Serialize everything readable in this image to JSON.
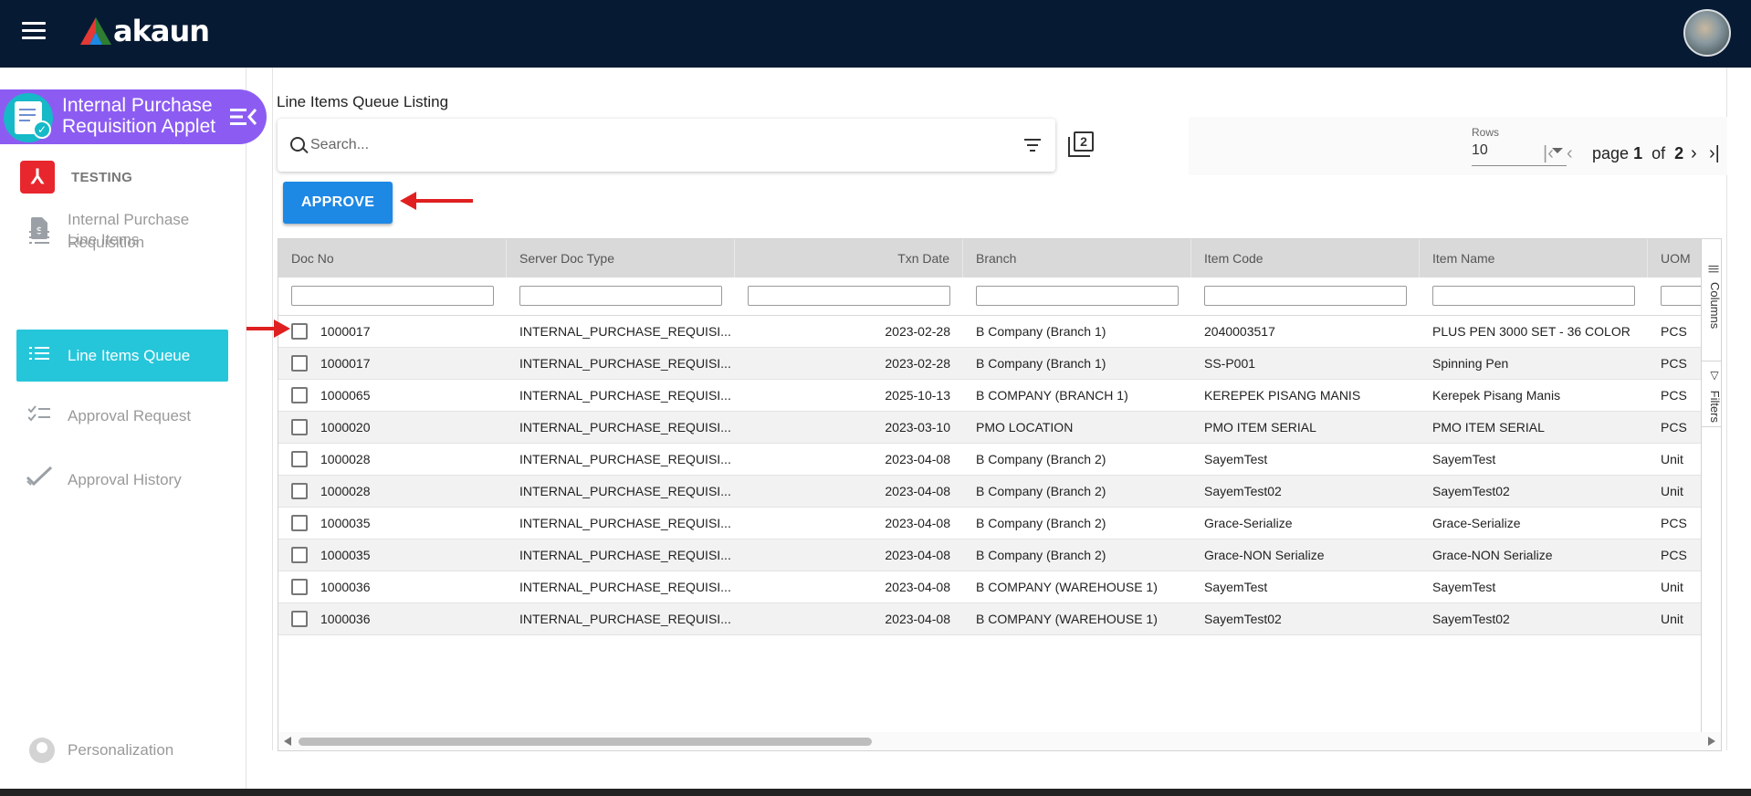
{
  "app": {
    "logo_text": "akaun"
  },
  "sidebar": {
    "applet_title_line1": "Internal Purchase",
    "applet_title_line2": "Requisition Applet",
    "company_name": "TESTING",
    "items": [
      {
        "label_line1": "Internal Purchase",
        "label_line2": "Requisition",
        "icon": "document-dollar-icon"
      },
      {
        "label": "Line Items",
        "icon": "list-icon"
      },
      {
        "label": "Line Items Queue",
        "icon": "list-icon",
        "active": true
      },
      {
        "label": "Approval Request",
        "icon": "checklist-icon"
      },
      {
        "label": "Approval History",
        "icon": "double-check-icon"
      }
    ],
    "personalization": "Personalization"
  },
  "main": {
    "page_title": "Line Items Queue Listing",
    "search_placeholder": "Search...",
    "copy_badge": "2",
    "approve_label": "APPROVE",
    "pager": {
      "rows_label": "Rows",
      "rows_value": "10",
      "page_word": "page",
      "current_page": "1",
      "of_word": "of",
      "total_pages": "2"
    }
  },
  "grid": {
    "columns": [
      "Doc No",
      "Server Doc Type",
      "Txn Date",
      "Branch",
      "Item Code",
      "Item Name",
      "UOM"
    ],
    "side_tabs": {
      "columns": "Columns",
      "filters": "Filters"
    },
    "rows": [
      [
        "1000017",
        "INTERNAL_PURCHASE_REQUISI...",
        "2023-02-28",
        "B Company (Branch 1)",
        "2040003517",
        "PLUS PEN 3000 SET - 36 COLOR",
        "PCS"
      ],
      [
        "1000017",
        "INTERNAL_PURCHASE_REQUISI...",
        "2023-02-28",
        "B Company (Branch 1)",
        "SS-P001",
        "Spinning Pen",
        "PCS"
      ],
      [
        "1000065",
        "INTERNAL_PURCHASE_REQUISI...",
        "2025-10-13",
        "B COMPANY (BRANCH 1)",
        "KEREPEK PISANG MANIS",
        "Kerepek Pisang Manis",
        "PCS"
      ],
      [
        "1000020",
        "INTERNAL_PURCHASE_REQUISI...",
        "2023-03-10",
        "PMO LOCATION",
        "PMO ITEM SERIAL",
        "PMO ITEM SERIAL",
        "PCS"
      ],
      [
        "1000028",
        "INTERNAL_PURCHASE_REQUISI...",
        "2023-04-08",
        "B Company (Branch 2)",
        "SayemTest",
        "SayemTest",
        "Unit"
      ],
      [
        "1000028",
        "INTERNAL_PURCHASE_REQUISI...",
        "2023-04-08",
        "B Company (Branch 2)",
        "SayemTest02",
        "SayemTest02",
        "Unit"
      ],
      [
        "1000035",
        "INTERNAL_PURCHASE_REQUISI...",
        "2023-04-08",
        "B Company (Branch 2)",
        "Grace-Serialize",
        "Grace-Serialize",
        "PCS"
      ],
      [
        "1000035",
        "INTERNAL_PURCHASE_REQUISI...",
        "2023-04-08",
        "B Company (Branch 2)",
        "Grace-NON Serialize",
        "Grace-NON Serialize",
        "PCS"
      ],
      [
        "1000036",
        "INTERNAL_PURCHASE_REQUISI...",
        "2023-04-08",
        "B COMPANY (WAREHOUSE 1)",
        "SayemTest",
        "SayemTest",
        "Unit"
      ],
      [
        "1000036",
        "INTERNAL_PURCHASE_REQUISI...",
        "2023-04-08",
        "B COMPANY (WAREHOUSE 1)",
        "SayemTest02",
        "SayemTest02",
        "Unit"
      ]
    ]
  },
  "colors": {
    "topbar": "#071a33",
    "applet_header": "#8c5cf2",
    "active_nav": "#26c6da",
    "approve_button": "#1e88e5",
    "annotation_arrow": "#e02020"
  }
}
